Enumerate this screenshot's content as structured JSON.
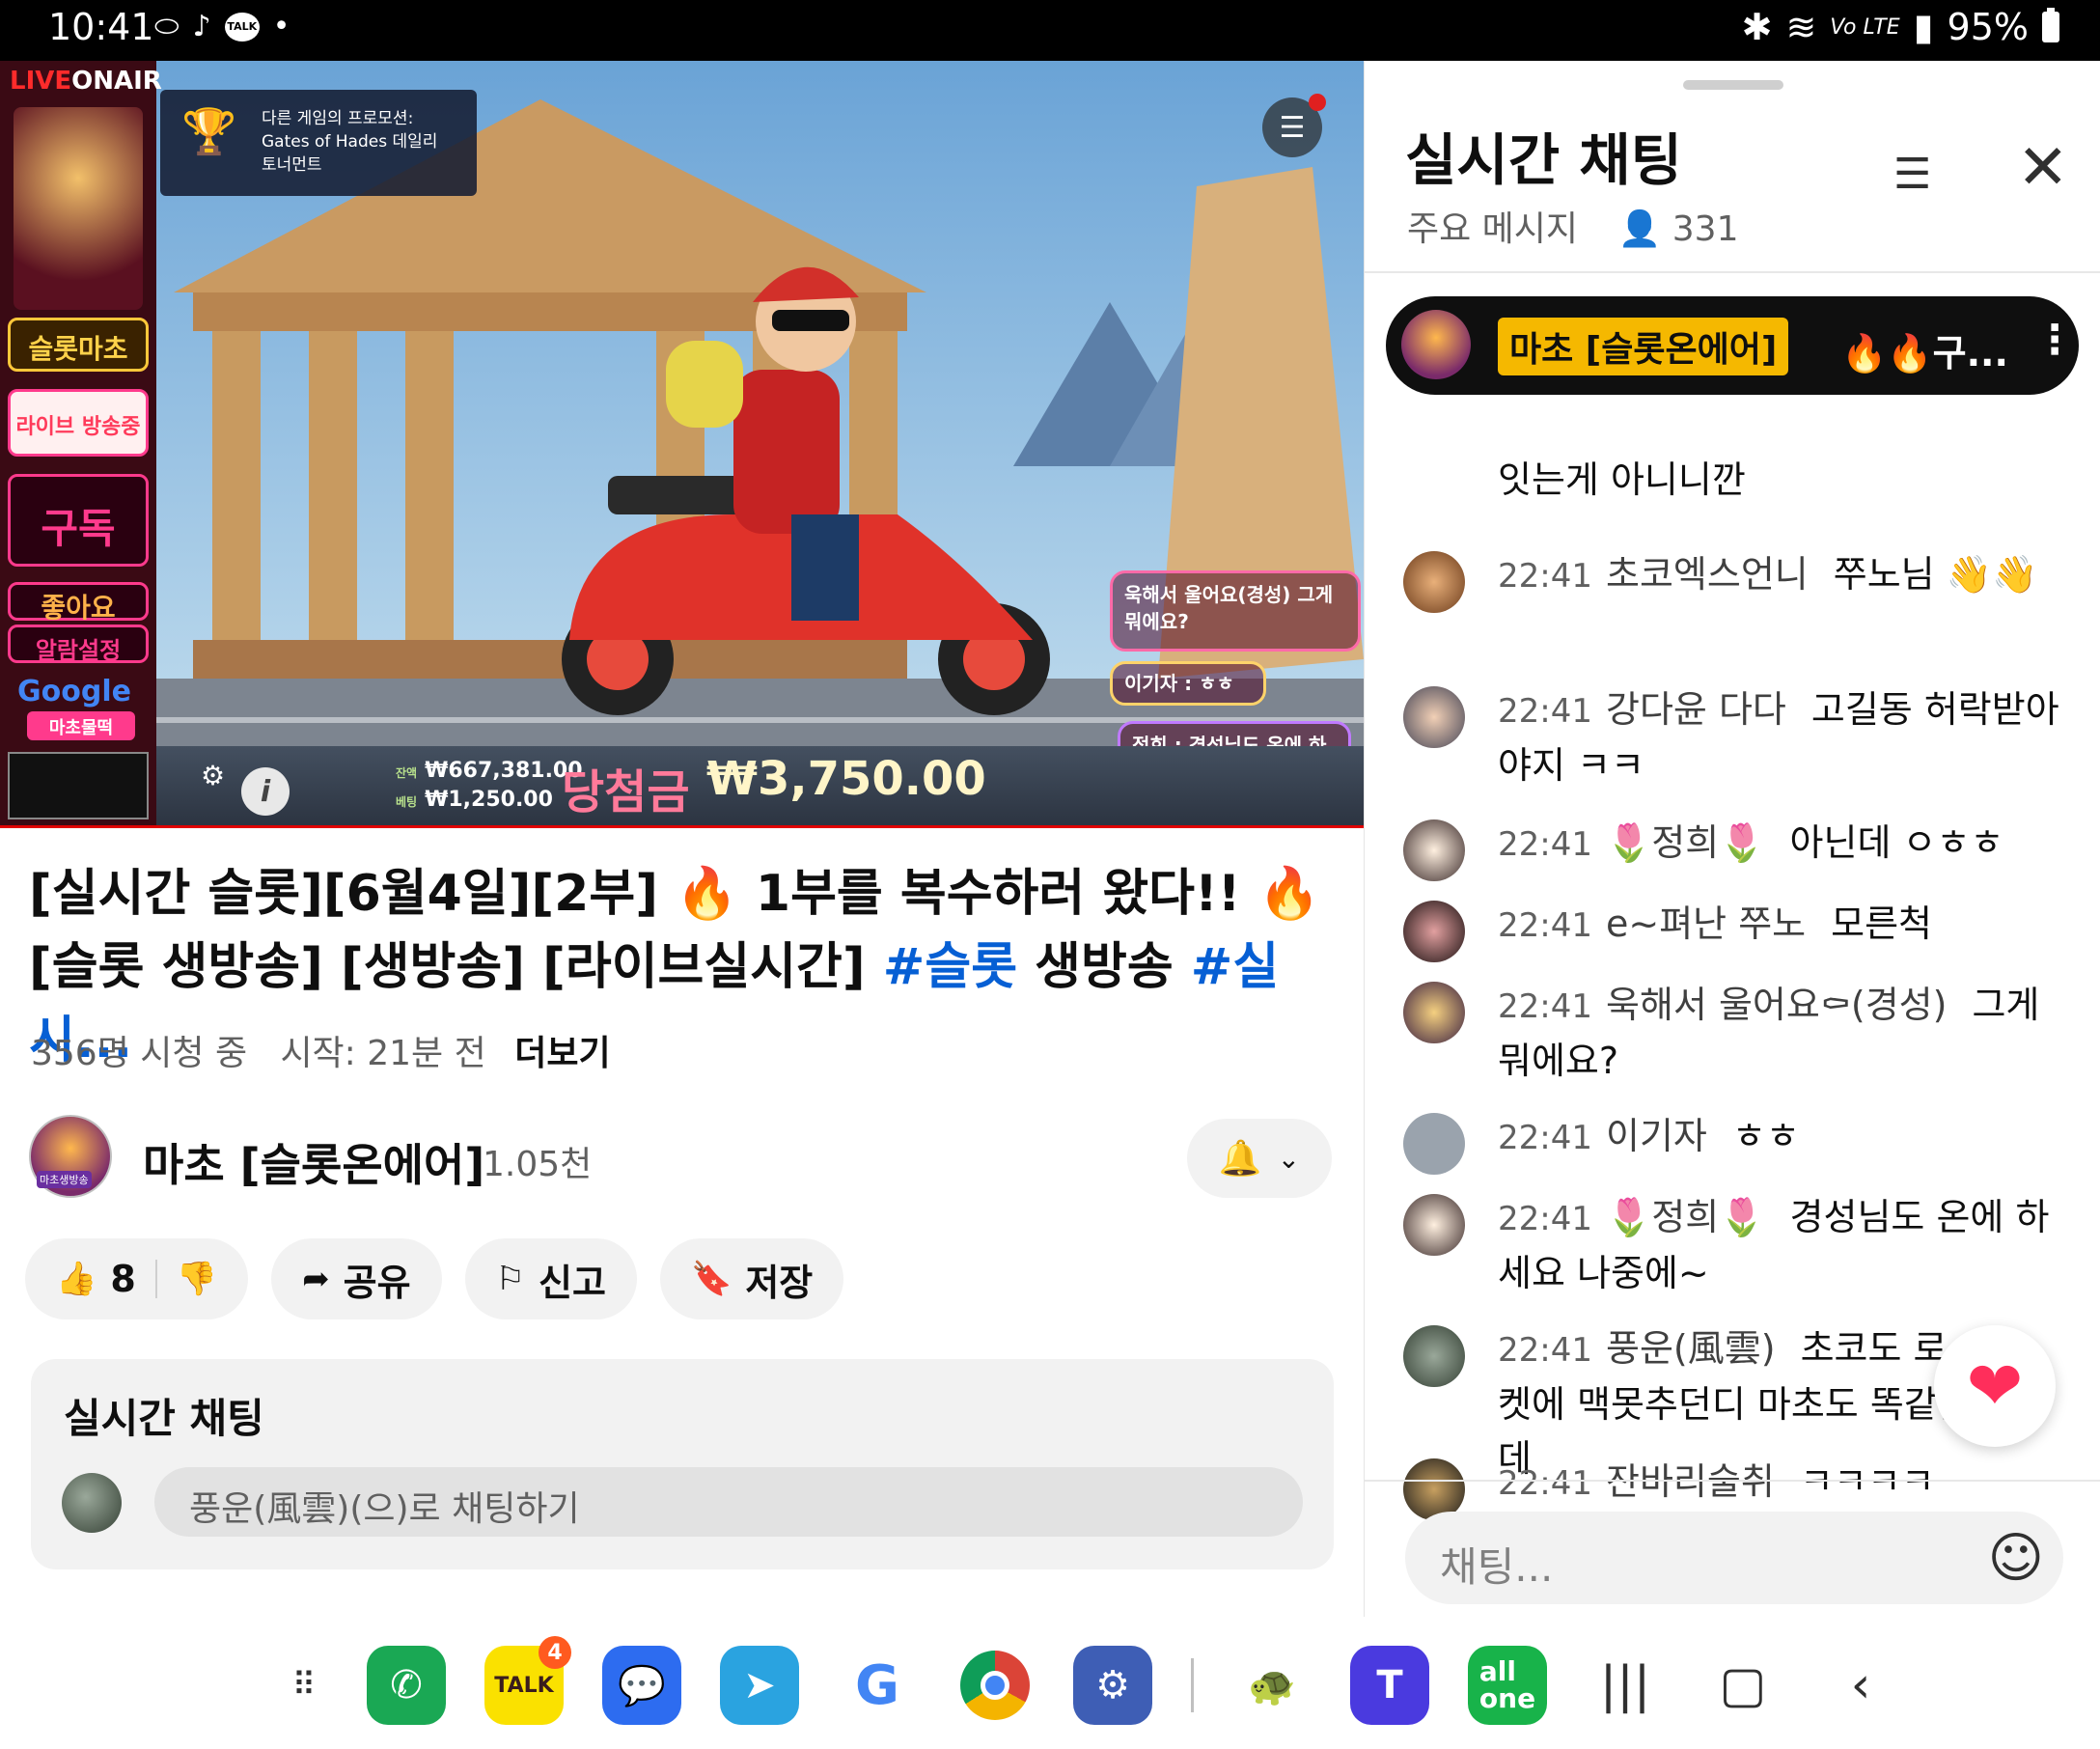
{
  "status_bar": {
    "time": "10:41",
    "network": "Vo LTE",
    "battery": "95%"
  },
  "video": {
    "brand_left": "LIVEONAIR",
    "promo_box_line1": "다른 게임의 프로모션:",
    "promo_box_line2": "Gates of Hades 데일리",
    "promo_box_line3": "토너먼트",
    "side_labels": [
      "슬롯마초",
      "라이브 방송중",
      "구독",
      "좋아요",
      "알람설정",
      "Google",
      "마초물떡"
    ],
    "overlay_chat_1": "욱해서 울어요(경성) 그게 뭐에요?",
    "overlay_chat_2": "이기자 : ㅎㅎ",
    "overlay_chat_3": "정희 : 경성님도 온에 하세요 나중에~",
    "balance_label": "잔액",
    "balance": "₩667,381.00",
    "bet_label": "베팅",
    "bet": "₩1,250.00",
    "win_label": "당첨금",
    "win_amount": "₩3,750.00"
  },
  "title": {
    "line1": "[실시간 슬롯][6월4일][2부] 🔥 1부를 복수하러 왔다!! 🔥",
    "line2_plain": "[슬롯 생방송] [생방송] [라이브실시간] ",
    "hashtag1": "#슬롯",
    "line2_mid": " 생방송 ",
    "hashtag2": "#실시..."
  },
  "meta": {
    "viewers": "356명 시청 중",
    "started": "시작: 21분 전",
    "more": "더보기"
  },
  "channel": {
    "avatar_label": "마초생방송",
    "name": "마초 [슬롯온에어]",
    "subscribers": "1.05천"
  },
  "actions": {
    "likes": "8",
    "share": "공유",
    "report": "신고",
    "save": "저장"
  },
  "live_chat_card": {
    "title": "실시간 채팅",
    "placeholder": "풍운(風雲)(으)로 채팅하기"
  },
  "chat_panel": {
    "title": "실시간 채팅",
    "mode": "주요 메시지",
    "viewer_count": "331",
    "pinned": {
      "author": "마초 [슬롯온에어]",
      "message": "🔥🔥구..."
    },
    "messages": [
      {
        "time": "",
        "author": "",
        "text": "잇는게 아니니깐"
      },
      {
        "time": "22:41",
        "author": "초코엑스언니",
        "text": "쭈노님 👋👋"
      },
      {
        "time": "22:41",
        "author": "강다윤 다다",
        "text": "고길동 허락받아야지 ㅋㅋ"
      },
      {
        "time": "22:41",
        "author": "🌷정희🌷",
        "text": "아닌데 ㅇㅎㅎ"
      },
      {
        "time": "22:41",
        "author": "e~펴난 쭈노",
        "text": "모른척"
      },
      {
        "time": "22:41",
        "author": "욱해서 울어요⚰(경성)",
        "text": "그게 뭐에요?"
      },
      {
        "time": "22:41",
        "author": "이기자",
        "text": "ㅎㅎ"
      },
      {
        "time": "22:41",
        "author": "🌷정희🌷",
        "text": "경성님도 온에 하세요 나중에~"
      },
      {
        "time": "22:41",
        "author": "풍운(風雲)",
        "text": "초코도 로켓에 맥못추던디 마초도 똑같은데"
      },
      {
        "time": "22:41",
        "author": "잔바리술취",
        "text": "ㅋㅋㅋㅋ"
      }
    ],
    "input_placeholder": "채팅..."
  },
  "dock": {
    "talk_badge": "4",
    "apps": [
      "phone-app",
      "kakaotalk",
      "messages",
      "telegram",
      "google",
      "chrome",
      "settings",
      "pokemon",
      "t-app",
      "all-one"
    ]
  },
  "colors": {
    "accent_blue": "#065fd4",
    "pinned_name_bg": "#f5b800",
    "live_red": "#e00000"
  }
}
